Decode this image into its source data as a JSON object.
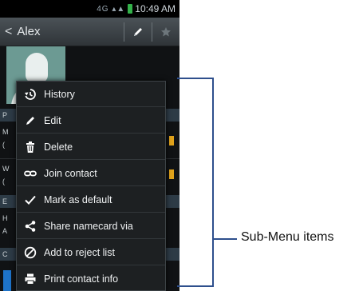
{
  "status_bar": {
    "time": "10:49 AM",
    "signal": "4G ▴▲"
  },
  "action_bar": {
    "back_glyph": "<",
    "title": "Alex"
  },
  "edge_letters": [
    "P",
    "M",
    "(",
    "W",
    "(",
    "E",
    "H",
    "A",
    "C"
  ],
  "menu": {
    "items": [
      {
        "label": "History",
        "icon": "history-icon"
      },
      {
        "label": "Edit",
        "icon": "edit-icon"
      },
      {
        "label": "Delete",
        "icon": "trash-icon"
      },
      {
        "label": "Join contact",
        "icon": "link-icon"
      },
      {
        "label": "Mark as default",
        "icon": "checkmark-icon"
      },
      {
        "label": "Share namecard via",
        "icon": "share-icon"
      },
      {
        "label": "Add to reject list",
        "icon": "block-icon"
      },
      {
        "label": "Print contact info",
        "icon": "printer-icon"
      }
    ]
  },
  "annotation": {
    "label": "Sub-Menu items"
  },
  "colors": {
    "accent_blue": "#2e4f8c",
    "menu_bg": "#1d2022",
    "status_green": "#33b24a"
  }
}
